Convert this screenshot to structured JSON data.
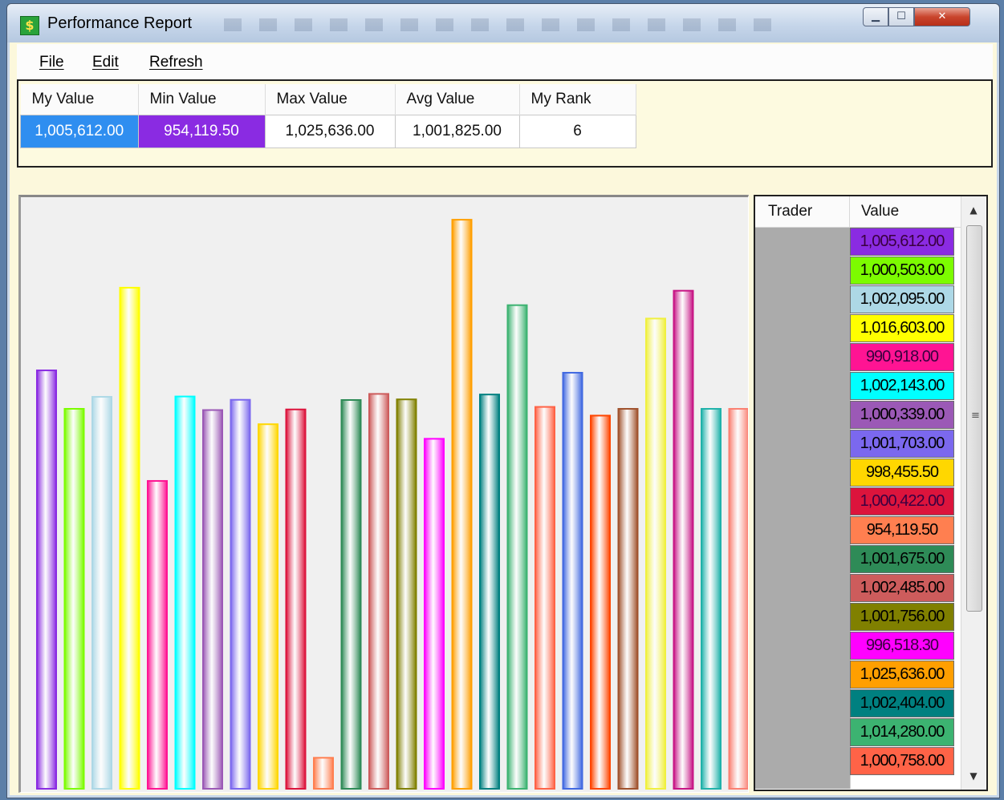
{
  "window": {
    "title": "Performance Report",
    "app_icon": "$"
  },
  "menu": {
    "items": [
      "File",
      "Edit",
      "Refresh"
    ]
  },
  "stats": {
    "headers": [
      "My Value",
      "Min Value",
      "Max Value",
      "Avg Value",
      "My Rank"
    ],
    "values": [
      "1,005,612.00",
      "954,119.50",
      "1,025,636.00",
      "1,001,825.00",
      "6"
    ],
    "my_value_color": "#2f8ef0",
    "min_value_color": "#8a2be2"
  },
  "grid": {
    "headers": {
      "trader": "Trader",
      "value": "Value"
    },
    "rows": [
      {
        "value": "1,005,612.00",
        "color": "#8a2be2"
      },
      {
        "value": "1,000,503.00",
        "color": "#7cfc00"
      },
      {
        "value": "1,002,095.00",
        "color": "#add8e6"
      },
      {
        "value": "1,016,603.00",
        "color": "#ffff00"
      },
      {
        "value": "990,918.00",
        "color": "#ff1493"
      },
      {
        "value": "1,002,143.00",
        "color": "#00ffff"
      },
      {
        "value": "1,000,339.00",
        "color": "#9b59b6"
      },
      {
        "value": "1,001,703.00",
        "color": "#7b68ee"
      },
      {
        "value": "998,455.50",
        "color": "#ffd700"
      },
      {
        "value": "1,000,422.00",
        "color": "#dc143c"
      },
      {
        "value": "954,119.50",
        "color": "#ff7f50"
      },
      {
        "value": "1,001,675.00",
        "color": "#2e8b57"
      },
      {
        "value": "1,002,485.00",
        "color": "#cd5c5c"
      },
      {
        "value": "1,001,756.00",
        "color": "#808000"
      },
      {
        "value": "996,518.30",
        "color": "#ff00ff"
      },
      {
        "value": "1,025,636.00",
        "color": "#ff9f00"
      },
      {
        "value": "1,002,404.00",
        "color": "#008080"
      },
      {
        "value": "1,014,280.00",
        "color": "#3cb371"
      },
      {
        "value": "1,000,758.00",
        "color": "#ff6347"
      }
    ]
  },
  "chart_data": {
    "type": "bar",
    "ylim": [
      950000,
      1026500
    ],
    "bars": [
      {
        "value": 1005612.0,
        "color": "#8a2be2"
      },
      {
        "value": 1000503.0,
        "color": "#7cfc00"
      },
      {
        "value": 1002095.0,
        "color": "#add8e6"
      },
      {
        "value": 1016603.0,
        "color": "#ffff00"
      },
      {
        "value": 990918.0,
        "color": "#ff1493"
      },
      {
        "value": 1002143.0,
        "color": "#00ffff"
      },
      {
        "value": 1000339.0,
        "color": "#9b59b6"
      },
      {
        "value": 1001703.0,
        "color": "#7b68ee"
      },
      {
        "value": 998455.5,
        "color": "#ffd700"
      },
      {
        "value": 1000422.0,
        "color": "#dc143c"
      },
      {
        "value": 954119.5,
        "color": "#ff7f50"
      },
      {
        "value": 1001675.0,
        "color": "#2e8b57"
      },
      {
        "value": 1002485.0,
        "color": "#cd5c5c"
      },
      {
        "value": 1001756.0,
        "color": "#808000"
      },
      {
        "value": 996518.3,
        "color": "#ff00ff"
      },
      {
        "value": 1025636.0,
        "color": "#ff9f00"
      },
      {
        "value": 1002404.0,
        "color": "#008080"
      },
      {
        "value": 1014280.0,
        "color": "#3cb371"
      },
      {
        "value": 1000758.0,
        "color": "#ff6347"
      },
      {
        "value": 1005300.0,
        "color": "#4169e1"
      },
      {
        "value": 999600.0,
        "color": "#ff4500"
      },
      {
        "value": 1000500.0,
        "color": "#a0522d"
      },
      {
        "value": 1012500.0,
        "color": "#f0f040"
      },
      {
        "value": 1016200.0,
        "color": "#c71585"
      },
      {
        "value": 1000500.0,
        "color": "#20b2aa"
      },
      {
        "value": 1000500.0,
        "color": "#fa8072"
      }
    ]
  }
}
